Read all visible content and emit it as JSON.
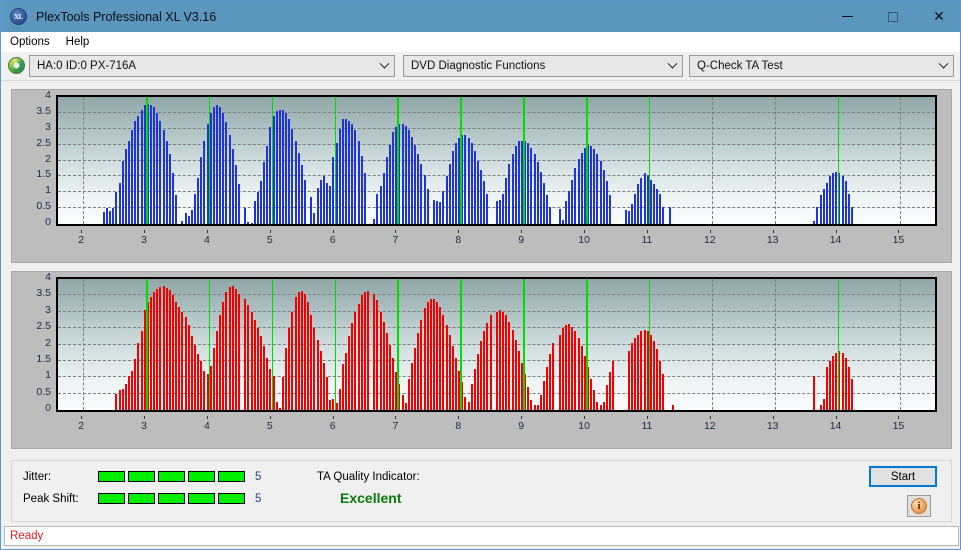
{
  "window": {
    "title": "PlexTools Professional XL V3.16",
    "app_icon": "XL",
    "minimize": "minimize-icon",
    "maximize": "maximize-icon",
    "close": "close-icon"
  },
  "menu": {
    "items": [
      "Options",
      "Help"
    ]
  },
  "toolbar": {
    "drive_icon": "disc-icon",
    "drive": "HA:0 ID:0  PX-716A",
    "function": "DVD Diagnostic Functions",
    "test": "Q-Check TA Test"
  },
  "results": {
    "jitter_label": "Jitter:",
    "jitter_value": "5",
    "jitter_segments": 5,
    "jitter_total": 5,
    "peak_label": "Peak Shift:",
    "peak_value": "5",
    "peak_segments": 5,
    "peak_total": 5,
    "ta_label": "TA Quality Indicator:",
    "ta_value": "Excellent",
    "ta_color": "#0a7a0a",
    "start_label": "Start",
    "info_icon": "info-icon"
  },
  "status": {
    "text": "Ready"
  },
  "colors": {
    "accent": "#5b96bf",
    "jitter_bar": "#00ee00",
    "marker": "#00dd00",
    "top_series": "#1f35d8",
    "bottom_series": "#f40000",
    "status_text": "#e02020"
  },
  "chart_data": [
    {
      "type": "bar",
      "title": "",
      "series_name": "Jitter",
      "color": "#1f35d8",
      "xlabel": "",
      "ylabel": "",
      "xlim": [
        1.6,
        15.55
      ],
      "ylim": [
        0,
        4
      ],
      "yticks": [
        0,
        0.5,
        1,
        1.5,
        2,
        2.5,
        3,
        3.5,
        4
      ],
      "xticks": [
        2,
        3,
        4,
        5,
        6,
        7,
        8,
        9,
        10,
        11,
        12,
        13,
        14,
        15
      ],
      "grid": true,
      "markers": [
        3,
        4,
        5,
        6,
        7,
        8,
        9,
        10,
        11,
        14
      ],
      "x": [
        2.33,
        2.38,
        2.43,
        2.48,
        2.53,
        2.58,
        2.63,
        2.68,
        2.73,
        2.78,
        2.83,
        2.88,
        2.93,
        2.98,
        3.03,
        3.08,
        3.13,
        3.18,
        3.23,
        3.28,
        3.33,
        3.38,
        3.43,
        3.48,
        3.58,
        3.63,
        3.68,
        3.73,
        3.78,
        3.83,
        3.88,
        3.93,
        3.98,
        4.03,
        4.08,
        4.13,
        4.18,
        4.23,
        4.28,
        4.33,
        4.38,
        4.43,
        4.48,
        4.58,
        4.63,
        4.68,
        4.73,
        4.78,
        4.83,
        4.88,
        4.93,
        4.98,
        5.03,
        5.08,
        5.13,
        5.18,
        5.23,
        5.28,
        5.33,
        5.38,
        5.43,
        5.48,
        5.53,
        5.63,
        5.68,
        5.73,
        5.78,
        5.83,
        5.88,
        5.93,
        5.98,
        6.03,
        6.08,
        6.13,
        6.18,
        6.23,
        6.28,
        6.33,
        6.38,
        6.43,
        6.48,
        6.63,
        6.68,
        6.73,
        6.78,
        6.83,
        6.88,
        6.93,
        6.98,
        7.03,
        7.08,
        7.13,
        7.18,
        7.23,
        7.28,
        7.33,
        7.38,
        7.43,
        7.48,
        7.58,
        7.63,
        7.68,
        7.73,
        7.78,
        7.83,
        7.88,
        7.93,
        7.98,
        8.03,
        8.08,
        8.13,
        8.18,
        8.23,
        8.28,
        8.33,
        8.38,
        8.43,
        8.58,
        8.63,
        8.68,
        8.73,
        8.78,
        8.83,
        8.88,
        8.93,
        8.98,
        9.03,
        9.08,
        9.13,
        9.18,
        9.23,
        9.28,
        9.33,
        9.38,
        9.43,
        9.58,
        9.63,
        9.68,
        9.73,
        9.78,
        9.83,
        9.88,
        9.93,
        9.98,
        10.03,
        10.08,
        10.13,
        10.18,
        10.23,
        10.28,
        10.33,
        10.38,
        10.63,
        10.68,
        10.73,
        10.78,
        10.83,
        10.88,
        10.93,
        10.98,
        11.03,
        11.08,
        11.13,
        11.18,
        11.23,
        11.33,
        13.63,
        13.68,
        13.73,
        13.78,
        13.83,
        13.88,
        13.93,
        13.98,
        14.03,
        14.08,
        14.13,
        14.18,
        14.23
      ],
      "values": [
        0.38,
        0.52,
        0.42,
        0.52,
        1.0,
        1.3,
        2.0,
        2.35,
        2.6,
        2.95,
        3.25,
        3.4,
        3.6,
        3.75,
        3.78,
        3.75,
        3.68,
        3.5,
        3.25,
        2.95,
        2.6,
        2.2,
        1.6,
        0.9,
        0.08,
        0.35,
        0.25,
        0.45,
        0.95,
        1.45,
        2.1,
        2.6,
        3.15,
        3.5,
        3.7,
        3.75,
        3.7,
        3.5,
        3.2,
        2.8,
        2.35,
        1.85,
        1.25,
        0.5,
        0.05,
        0.02,
        0.72,
        1.0,
        1.35,
        1.95,
        2.45,
        3.05,
        3.4,
        3.55,
        3.6,
        3.58,
        3.5,
        3.3,
        3.0,
        2.6,
        2.25,
        1.85,
        1.4,
        0.85,
        0.35,
        1.15,
        1.4,
        1.5,
        1.3,
        1.2,
        2.1,
        2.55,
        3.0,
        3.3,
        3.3,
        3.25,
        3.15,
        2.95,
        2.6,
        2.15,
        1.6,
        0.15,
        0.95,
        1.2,
        1.6,
        2.1,
        2.5,
        2.9,
        3.05,
        3.15,
        3.15,
        3.1,
        2.95,
        2.75,
        2.5,
        2.2,
        1.9,
        1.55,
        1.1,
        0.75,
        0.72,
        0.7,
        1.05,
        1.5,
        1.9,
        2.3,
        2.55,
        2.7,
        2.8,
        2.8,
        2.72,
        2.55,
        2.3,
        2.0,
        1.7,
        1.35,
        0.95,
        0.72,
        0.75,
        0.95,
        1.45,
        1.9,
        2.2,
        2.45,
        2.6,
        2.62,
        2.6,
        2.55,
        2.4,
        2.2,
        1.95,
        1.65,
        1.3,
        0.9,
        0.55,
        0.48,
        0.12,
        0.72,
        1.05,
        1.4,
        1.75,
        2.05,
        2.25,
        2.4,
        2.48,
        2.45,
        2.35,
        2.2,
        2.0,
        1.7,
        1.35,
        0.9,
        0.45,
        0.4,
        0.62,
        0.95,
        1.25,
        1.45,
        1.6,
        1.55,
        1.4,
        1.25,
        1.1,
        0.95,
        0.55,
        0.55,
        0.1,
        0.55,
        0.9,
        1.1,
        1.3,
        1.5,
        1.6,
        1.65,
        1.6,
        1.5,
        1.35,
        0.95,
        0.55
      ]
    },
    {
      "type": "bar",
      "title": "",
      "series_name": "Peak Shift",
      "color": "#f40000",
      "xlabel": "",
      "ylabel": "",
      "xlim": [
        1.6,
        15.55
      ],
      "ylim": [
        0,
        4
      ],
      "yticks": [
        0,
        0.5,
        1,
        1.5,
        2,
        2.5,
        3,
        3.5,
        4
      ],
      "xticks": [
        2,
        3,
        4,
        5,
        6,
        7,
        8,
        9,
        10,
        11,
        12,
        13,
        14,
        15
      ],
      "grid": true,
      "markers": [
        3,
        4,
        5,
        6,
        7,
        8,
        9,
        10,
        11,
        14
      ],
      "x": [
        2.53,
        2.58,
        2.63,
        2.68,
        2.73,
        2.78,
        2.83,
        2.88,
        2.93,
        2.98,
        3.03,
        3.08,
        3.13,
        3.18,
        3.23,
        3.28,
        3.33,
        3.38,
        3.43,
        3.48,
        3.53,
        3.58,
        3.63,
        3.68,
        3.73,
        3.78,
        3.83,
        3.88,
        3.93,
        3.98,
        4.03,
        4.08,
        4.13,
        4.18,
        4.23,
        4.28,
        4.33,
        4.38,
        4.43,
        4.48,
        4.58,
        4.63,
        4.68,
        4.73,
        4.78,
        4.83,
        4.88,
        4.93,
        4.98,
        5.03,
        5.08,
        5.13,
        5.18,
        5.23,
        5.28,
        5.33,
        5.38,
        5.43,
        5.48,
        5.53,
        5.58,
        5.63,
        5.68,
        5.73,
        5.78,
        5.83,
        5.88,
        5.93,
        5.98,
        6.03,
        6.08,
        6.13,
        6.18,
        6.23,
        6.28,
        6.33,
        6.38,
        6.43,
        6.48,
        6.53,
        6.63,
        6.68,
        6.73,
        6.78,
        6.83,
        6.88,
        6.93,
        6.98,
        7.03,
        7.08,
        7.13,
        7.18,
        7.23,
        7.28,
        7.33,
        7.38,
        7.43,
        7.48,
        7.53,
        7.58,
        7.63,
        7.68,
        7.73,
        7.78,
        7.83,
        7.88,
        7.93,
        7.98,
        8.03,
        8.08,
        8.13,
        8.18,
        8.23,
        8.28,
        8.33,
        8.38,
        8.43,
        8.48,
        8.58,
        8.63,
        8.68,
        8.73,
        8.78,
        8.83,
        8.88,
        8.93,
        8.98,
        9.03,
        9.08,
        9.13,
        9.18,
        9.23,
        9.28,
        9.33,
        9.38,
        9.43,
        9.48,
        9.58,
        9.63,
        9.68,
        9.73,
        9.78,
        9.83,
        9.88,
        9.93,
        9.98,
        10.03,
        10.08,
        10.13,
        10.18,
        10.23,
        10.28,
        10.33,
        10.38,
        10.43,
        10.68,
        10.73,
        10.78,
        10.83,
        10.88,
        10.93,
        10.98,
        11.03,
        11.08,
        11.13,
        11.18,
        11.23,
        11.38,
        13.63,
        13.73,
        13.78,
        13.83,
        13.88,
        13.93,
        13.98,
        14.03,
        14.08,
        14.13,
        14.18,
        14.23
      ],
      "values": [
        0.5,
        0.6,
        0.65,
        0.8,
        1.05,
        1.2,
        1.55,
        2.05,
        2.4,
        3.05,
        3.3,
        3.45,
        3.6,
        3.7,
        3.75,
        3.78,
        3.72,
        3.65,
        3.5,
        3.3,
        3.15,
        3.0,
        2.85,
        2.6,
        2.25,
        2.0,
        1.7,
        1.5,
        1.2,
        1.1,
        1.35,
        1.9,
        2.4,
        2.9,
        3.3,
        3.6,
        3.75,
        3.78,
        3.7,
        3.55,
        3.4,
        3.2,
        3.0,
        2.75,
        2.5,
        2.25,
        1.95,
        1.6,
        1.25,
        1.05,
        0.25,
        0.05,
        1.0,
        1.9,
        2.5,
        3.0,
        3.45,
        3.6,
        3.62,
        3.55,
        3.3,
        2.9,
        2.5,
        2.15,
        1.8,
        1.45,
        1.0,
        0.3,
        0.35,
        0.2,
        0.65,
        1.4,
        1.75,
        2.25,
        2.65,
        3.0,
        3.25,
        3.5,
        3.6,
        3.62,
        3.55,
        3.35,
        3.0,
        2.7,
        2.35,
        2.0,
        1.6,
        1.15,
        0.8,
        0.45,
        0.2,
        0.95,
        1.45,
        1.9,
        2.35,
        2.75,
        3.1,
        3.3,
        3.38,
        3.4,
        3.3,
        3.15,
        2.9,
        2.6,
        2.3,
        1.95,
        1.6,
        1.2,
        0.85,
        0.4,
        0.25,
        0.8,
        1.25,
        1.7,
        2.1,
        2.4,
        2.65,
        2.9,
        3.0,
        3.05,
        3.0,
        2.9,
        2.7,
        2.45,
        2.15,
        1.8,
        1.45,
        1.1,
        0.7,
        0.3,
        0.15,
        0.15,
        0.45,
        0.9,
        1.3,
        1.7,
        2.05,
        2.3,
        2.5,
        2.6,
        2.62,
        2.55,
        2.4,
        2.2,
        1.95,
        1.65,
        1.3,
        0.95,
        0.6,
        0.25,
        0.15,
        0.25,
        0.75,
        1.15,
        1.5,
        1.8,
        2.05,
        2.2,
        2.3,
        2.4,
        2.45,
        2.4,
        2.3,
        2.1,
        1.85,
        1.5,
        1.1,
        0.15,
        1.05,
        0.15,
        0.35,
        1.3,
        1.5,
        1.65,
        1.75,
        1.8,
        1.75,
        1.6,
        1.3,
        0.95
      ]
    }
  ]
}
